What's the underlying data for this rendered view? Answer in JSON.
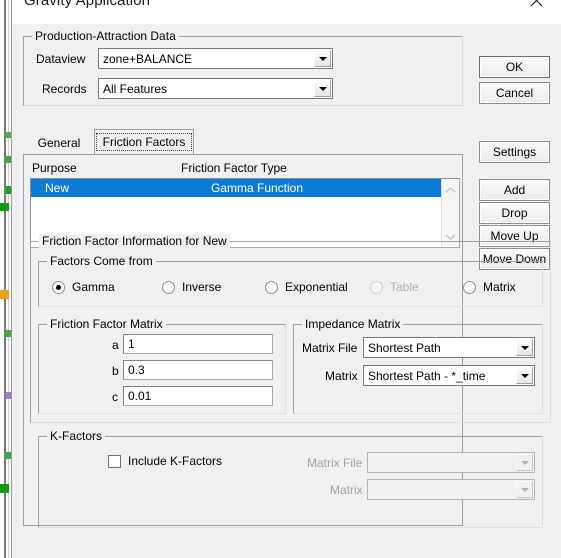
{
  "window": {
    "title": "Gravity Application",
    "close_icon": "close-icon"
  },
  "production_attraction": {
    "group_label": "Production-Attraction Data",
    "dataview_label": "Dataview",
    "dataview_value": "zone+BALANCE",
    "records_label": "Records",
    "records_value": "All Features"
  },
  "actions": {
    "ok": "OK",
    "cancel": "Cancel",
    "settings": "Settings",
    "add": "Add",
    "drop": "Drop",
    "move_up": "Move Up",
    "move_down": "Move Down"
  },
  "tabs": [
    {
      "label": "General",
      "active": false
    },
    {
      "label": "Friction Factors",
      "active": true
    }
  ],
  "list": {
    "columns": [
      "Purpose",
      "Friction Factor Type"
    ],
    "rows": [
      {
        "purpose": "New",
        "type": "Gamma Function",
        "selected": true
      }
    ],
    "scroll_up_icon": "chevron-up-icon",
    "scroll_down_icon": "chevron-down-icon"
  },
  "friction_info": {
    "group_label": "Friction Factor Information for New",
    "source_group_label": "Factors Come from",
    "options": [
      {
        "label": "Gamma",
        "selected": true,
        "disabled": false
      },
      {
        "label": "Inverse",
        "selected": false,
        "disabled": false
      },
      {
        "label": "Exponential",
        "selected": false,
        "disabled": false
      },
      {
        "label": "Table",
        "selected": false,
        "disabled": true
      },
      {
        "label": "Matrix",
        "selected": false,
        "disabled": false
      }
    ]
  },
  "friction_matrix": {
    "group_label": "Friction Factor Matrix",
    "fields": [
      {
        "label": "a",
        "value": "1"
      },
      {
        "label": "b",
        "value": "0.3"
      },
      {
        "label": "c",
        "value": "0.01"
      }
    ]
  },
  "impedance_matrix": {
    "group_label": "Impedance Matrix",
    "matrix_file_label": "Matrix File",
    "matrix_file_value": "Shortest Path",
    "matrix_label": "Matrix",
    "matrix_value": "Shortest Path - *_time"
  },
  "k_factors": {
    "group_label": "K-Factors",
    "include_label": "Include K-Factors",
    "include_checked": false,
    "matrix_file_label": "Matrix File",
    "matrix_file_value": "",
    "matrix_label": "Matrix",
    "matrix_value": ""
  },
  "colors": {
    "selection_blue": "#0a7ad6",
    "dialog_face": "#f0f0f0",
    "disabled_text": "#a3a3a3"
  }
}
